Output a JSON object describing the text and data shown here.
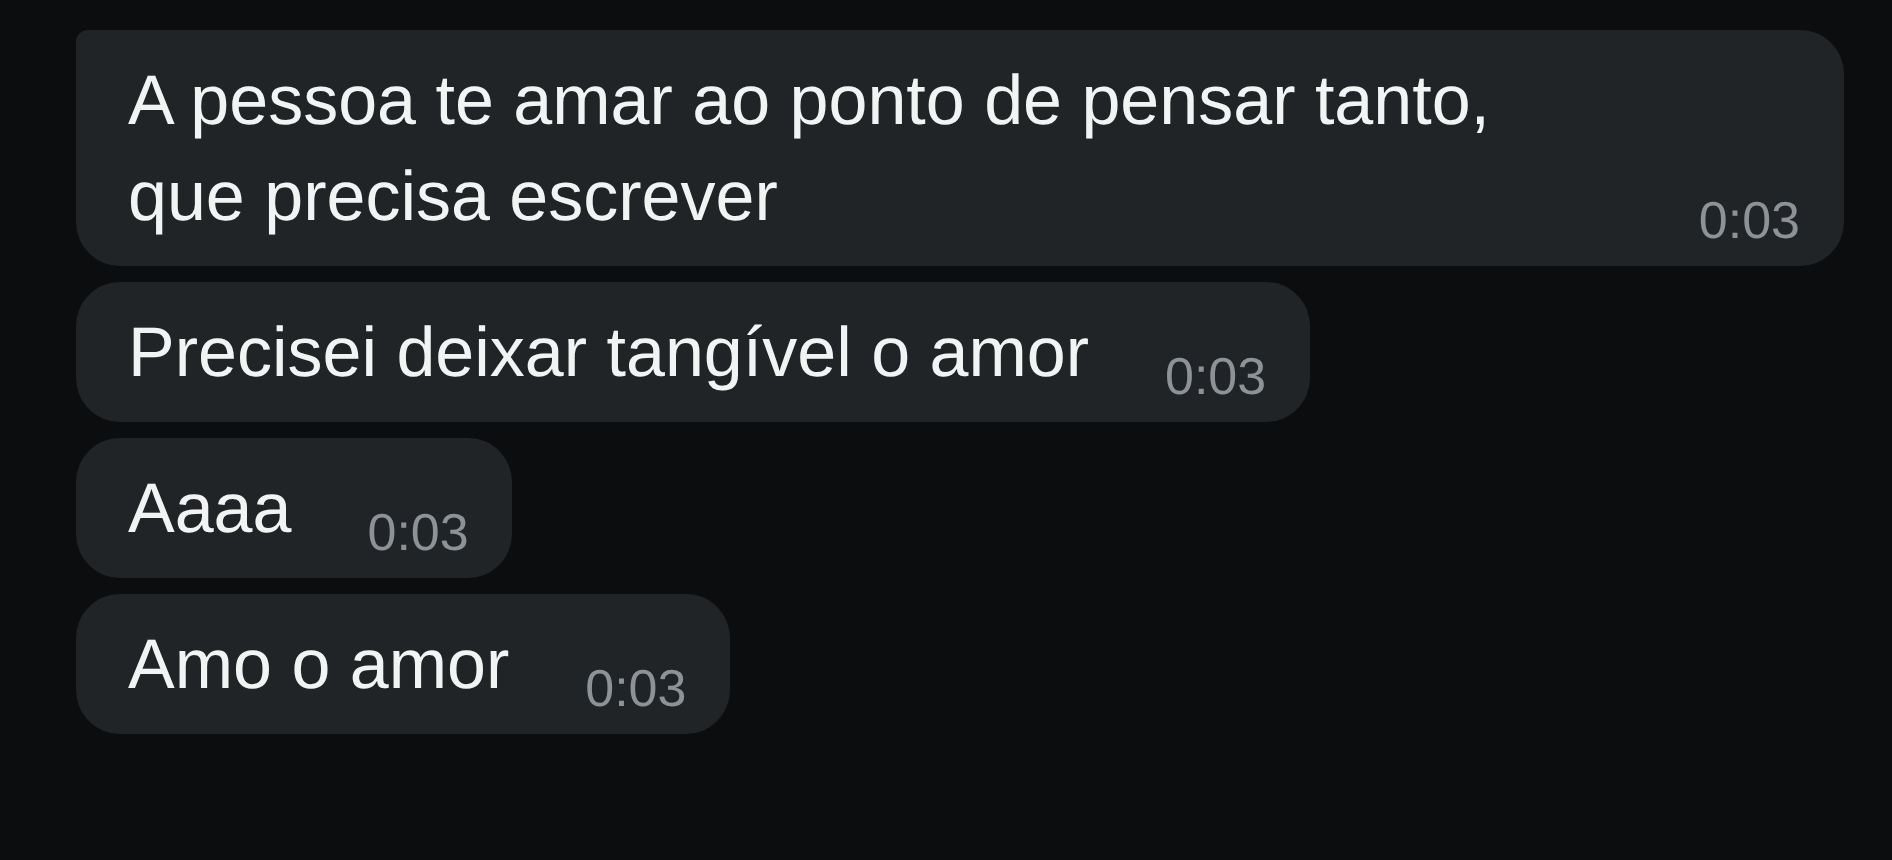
{
  "messages": [
    {
      "text": "A pessoa te amar ao ponto de pensar tanto, que precisa escrever",
      "time": "0:03"
    },
    {
      "text": "Precisei deixar tangível o amor",
      "time": "0:03"
    },
    {
      "text": "Aaaa",
      "time": "0:03"
    },
    {
      "text": "Amo o amor",
      "time": "0:03"
    }
  ]
}
